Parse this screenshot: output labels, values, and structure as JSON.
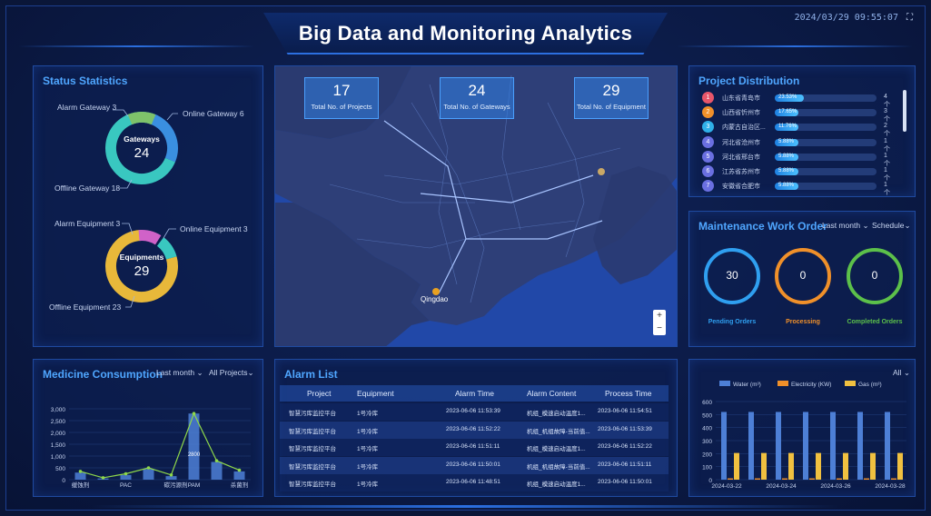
{
  "header": {
    "title": "Big Data  and Monitoring Analytics",
    "timestamp": "2024/03/29 09:55:07",
    "fullscreen_icon": "expand-icon"
  },
  "status_statistics": {
    "title": "Status Statistics",
    "gateways": {
      "center_label": "Gateways",
      "total": "24",
      "alarm_label": "Alarm Gateway  3",
      "online_label": "Online Gateway  6",
      "offline_label": "Offline Gateway  18",
      "colors": {
        "alarm": "#7ec26a",
        "online": "#3a8fe0",
        "offline": "#39c7c0"
      }
    },
    "equipments": {
      "center_label": "Equipments",
      "total": "29",
      "alarm_label": "Alarm Equipment  3",
      "online_label": "Online Equipment  3",
      "offline_label": "Offline Equipment  23",
      "colors": {
        "alarm": "#d062c8",
        "online": "#39c7c0",
        "offline": "#e8b83a"
      }
    }
  },
  "map": {
    "kpis": [
      {
        "value": "17",
        "label": "Total No. of Projects"
      },
      {
        "value": "24",
        "label": "Total No. of Gateways"
      },
      {
        "value": "29",
        "label": "Total No. of Equipment"
      }
    ],
    "city_label": "Qingdao",
    "zoom_in": "+",
    "zoom_out": "−"
  },
  "project_distribution": {
    "title": "Project Distribution",
    "rows": [
      {
        "rank": "1",
        "name": "山东省青岛市",
        "pct": "23.53%",
        "fill": 0.2353,
        "count": "4个",
        "color": "#e8566a"
      },
      {
        "rank": "2",
        "name": "山西省忻州市",
        "pct": "17.65%",
        "fill": 0.1765,
        "count": "3个",
        "color": "#f0902a"
      },
      {
        "rank": "3",
        "name": "内蒙古自治区...",
        "pct": "11.76%",
        "fill": 0.1176,
        "count": "2个",
        "color": "#2fb0e8"
      },
      {
        "rank": "4",
        "name": "河北省沧州市",
        "pct": "5.88%",
        "fill": 0.0588,
        "count": "1个",
        "color": "#6a6fe0"
      },
      {
        "rank": "5",
        "name": "河北省邢台市",
        "pct": "5.88%",
        "fill": 0.0588,
        "count": "1个",
        "color": "#6a6fe0"
      },
      {
        "rank": "6",
        "name": "江苏省苏州市",
        "pct": "5.88%",
        "fill": 0.0588,
        "count": "1个",
        "color": "#6a6fe0"
      },
      {
        "rank": "7",
        "name": "安徽省合肥市",
        "pct": "5.88%",
        "fill": 0.0588,
        "count": "1个",
        "color": "#6a6fe0"
      }
    ]
  },
  "maintenance": {
    "title": "Maintenance Work Order",
    "period_dropdown": "Last month",
    "type_dropdown": "Schedule",
    "orders": [
      {
        "value": "30",
        "label": "Pending Orders",
        "color": "#2f9ff0"
      },
      {
        "value": "0",
        "label": "Processing",
        "color": "#f0902a"
      },
      {
        "value": "0",
        "label": "Completed Orders",
        "color": "#5cc04a"
      }
    ]
  },
  "medicine": {
    "title": "Medicine Consumption",
    "period_dropdown": "Last month",
    "project_dropdown": "All Projects"
  },
  "alarm_list": {
    "title": "Alarm List",
    "columns": [
      "Project",
      "Equipment",
      "Alarm Time",
      "Alarm Content",
      "Process Time"
    ],
    "rows": [
      [
        "智慧污库监控平台",
        "1号冷库",
        "2023-06-06 11:53:39",
        "机组_模速启动温度1...",
        "2023-06-06 11:54:51"
      ],
      [
        "智慧污库监控平台",
        "1号冷库",
        "2023-06-06 11:52:22",
        "机组_机组故障-当前值...",
        "2023-06-06 11:53:39"
      ],
      [
        "智慧污库监控平台",
        "1号冷库",
        "2023-06-06 11:51:11",
        "机组_模速启动温度1...",
        "2023-06-06 11:52:22"
      ],
      [
        "智慧污库监控平台",
        "1号冷库",
        "2023-06-06 11:50:01",
        "机组_机组故障-当前值...",
        "2023-06-06 11:51:11"
      ],
      [
        "智慧污库监控平台",
        "1号冷库",
        "2023-06-06 11:48:51",
        "机组_模速启动温度1...",
        "2023-06-06 11:50:01"
      ]
    ]
  },
  "energy": {
    "filter_dropdown": "All"
  },
  "chart_data": [
    {
      "type": "bar",
      "title": "Medicine Consumption",
      "categories": [
        "缓蚀剂",
        "PAC",
        "阻垢剂",
        "PAM",
        "杀菌剂"
      ],
      "category_labels": [
        "缓蚀剂",
        "PAC",
        "碳污源剂",
        "PAM",
        "杀菌剂"
      ],
      "x": [
        "缓蚀剂",
        "",
        "PAC",
        "",
        "碳污源剂",
        "",
        "PAM",
        "",
        "杀菌剂"
      ],
      "bar_values": [
        300,
        50,
        200,
        450,
        150,
        2800,
        750,
        350
      ],
      "line_values": [
        350,
        80,
        250,
        500,
        200,
        2800,
        800,
        400
      ],
      "highlight_label": "2800",
      "yticks": [
        "0",
        "500",
        "1,000",
        "1,500",
        "2,000",
        "2,500",
        "3,000"
      ],
      "ylim": [
        0,
        3000
      ],
      "colors": {
        "bar": "#4d7fd6",
        "line": "#8fd84a"
      }
    },
    {
      "type": "bar",
      "series": [
        {
          "name": "Water (m³)",
          "values": [
            520,
            520,
            520,
            520,
            520,
            520,
            520
          ],
          "color": "#4d7fd6"
        },
        {
          "name": "Electricity (KW)",
          "values": [
            10,
            10,
            10,
            10,
            10,
            10,
            10
          ],
          "color": "#f0902a"
        },
        {
          "name": "Gas (m³)",
          "values": [
            205,
            205,
            205,
            205,
            205,
            205,
            205
          ],
          "color": "#f0c040"
        }
      ],
      "categories": [
        "2024-03-22",
        "2024-03-23",
        "2024-03-24",
        "2024-03-25",
        "2024-03-26",
        "2024-03-27",
        "2024-03-28"
      ],
      "xtick_labels": [
        "2024-03-22",
        "2024-03-24",
        "2024-03-26",
        "2024-03-28"
      ],
      "yticks": [
        "0",
        "100",
        "200",
        "300",
        "400",
        "500",
        "600"
      ],
      "ylim": [
        0,
        600
      ],
      "legend": "top-right"
    }
  ]
}
